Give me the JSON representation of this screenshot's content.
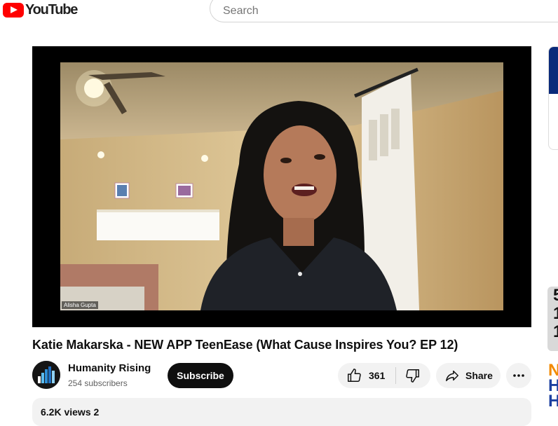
{
  "header": {
    "logo_text": "YouTube",
    "logo_icon": "youtube-play-icon",
    "search_placeholder": "Search"
  },
  "player": {
    "participant_name": "Alisha Gupta"
  },
  "video": {
    "title": "Katie Makarska - NEW APP TeenEase (What Cause Inspires You? EP 12)"
  },
  "channel": {
    "name": "Humanity Rising",
    "subscribers": "254 subscribers",
    "subscribe_label": "Subscribe"
  },
  "actions": {
    "like_count": "361",
    "share_label": "Share",
    "icons": [
      "thumbs-up-icon",
      "thumbs-down-icon",
      "share-arrow-icon",
      "more-dots-icon"
    ]
  },
  "description": {
    "views_partial": "6.2K views  2"
  },
  "rail": {
    "thumb_chars": [
      "5",
      "1",
      "1"
    ],
    "thumb2_chars": [
      "N",
      "H",
      "H"
    ]
  },
  "colors": {
    "brand_red": "#ff0000",
    "button_dark": "#0f0f0f",
    "pill_bg": "#f2f2f2"
  }
}
